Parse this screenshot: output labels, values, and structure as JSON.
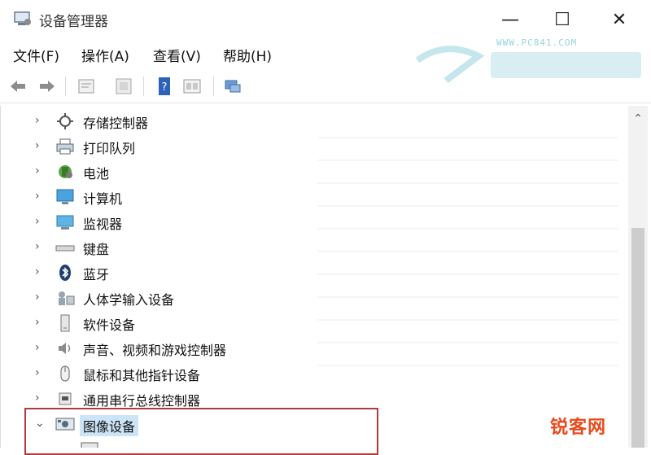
{
  "window": {
    "title": "设备管理器",
    "controls": {
      "minimize": "—",
      "maximize": "☐",
      "close": "✕"
    }
  },
  "menu": [
    {
      "label": "文件(F)"
    },
    {
      "label": "操作(A)"
    },
    {
      "label": "查看(V)"
    },
    {
      "label": "帮助(H)"
    }
  ],
  "watermarks": {
    "top_url": "WWW.PC841.COM",
    "bottom": "锐客网"
  },
  "toolbar": {
    "buttons": [
      "back-icon",
      "forward-icon",
      "properties-icon",
      "update-driver-icon",
      "help-icon",
      "scan-hardware-icon",
      "device-monitor-icon"
    ]
  },
  "tree": {
    "nodes": [
      {
        "label": "存储控制器",
        "icon": "storage-controller-icon",
        "expanded": false
      },
      {
        "label": "打印队列",
        "icon": "printer-icon",
        "expanded": false
      },
      {
        "label": "电池",
        "icon": "battery-icon",
        "expanded": false
      },
      {
        "label": "计算机",
        "icon": "computer-icon",
        "expanded": false
      },
      {
        "label": "监视器",
        "icon": "monitor-icon",
        "expanded": false
      },
      {
        "label": "键盘",
        "icon": "keyboard-icon",
        "expanded": false
      },
      {
        "label": "蓝牙",
        "icon": "bluetooth-icon",
        "expanded": false
      },
      {
        "label": "人体学输入设备",
        "icon": "hid-icon",
        "expanded": false
      },
      {
        "label": "软件设备",
        "icon": "software-device-icon",
        "expanded": false
      },
      {
        "label": "声音、视频和游戏控制器",
        "icon": "sound-icon",
        "expanded": false
      },
      {
        "label": "鼠标和其他指针设备",
        "icon": "mouse-icon",
        "expanded": false
      },
      {
        "label": "通用串行总线控制器",
        "icon": "usb-icon",
        "expanded": false
      },
      {
        "label": "图像设备",
        "icon": "imaging-device-icon",
        "expanded": true,
        "selected": true
      }
    ]
  },
  "colors": {
    "highlight_border": "#b33a3a",
    "selection": "#cce4f7",
    "watermark_red": "#e84a1d"
  }
}
